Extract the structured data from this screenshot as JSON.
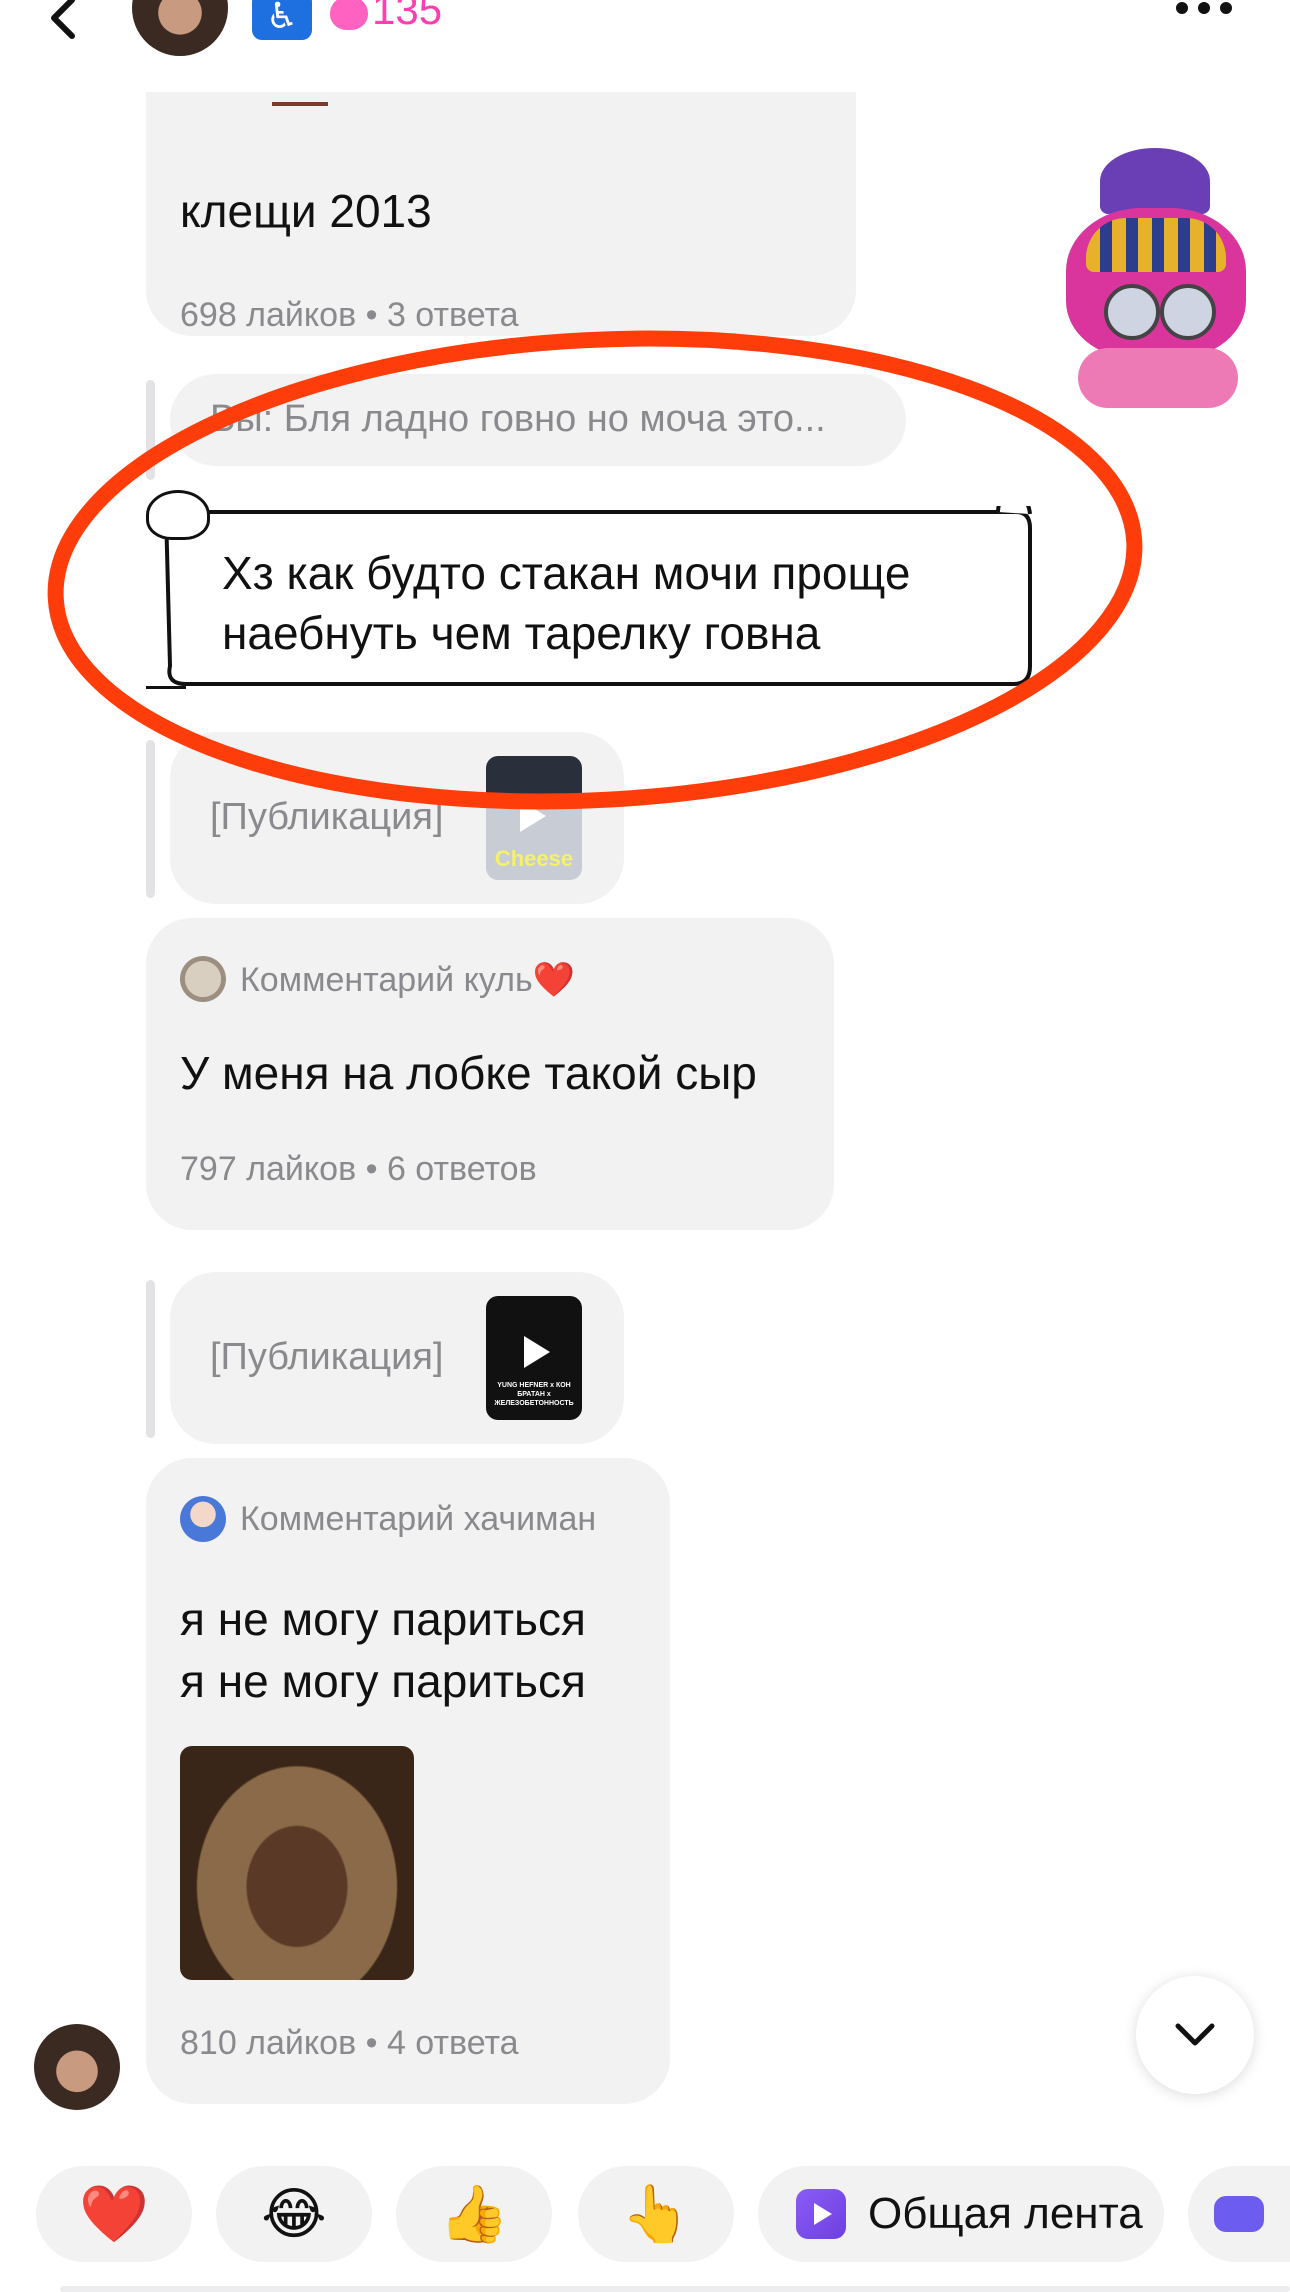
{
  "header": {
    "streak": "135",
    "back_icon": "chevron-left-icon",
    "more_icon": "ellipsis-icon",
    "badge_icon": "accessibility-icon",
    "streak_icon": "flame-icon"
  },
  "messages": {
    "top_comment": {
      "text": "клещи 2013",
      "meta": "698 лайков • 3 ответа"
    },
    "reply_preview": "Вы: Бля ладно говно но моча это...",
    "scroll_message": {
      "line1": "Хз как будто стакан мочи проще",
      "line2": "наебнуть чем тарелку говна"
    },
    "post1": {
      "label": "[Публикация]",
      "thumb_caption": "Cheese"
    },
    "comment1": {
      "author": "Комментарий куль",
      "heart": "❤️",
      "text": "У меня на лобке такой сыр",
      "meta": "797 лайков • 6 ответов"
    },
    "post2": {
      "label": "[Публикация]",
      "thumb_caption": "YUNG HEFNER x КОН БРАТАН x ЖЕЛЕЗОБЕТОННОСТЬ"
    },
    "comment2": {
      "author": "Комментарий хачиман",
      "line1": "я не могу париться",
      "line2": "я не могу париться",
      "meta": "810 лайков • 4 ответа"
    }
  },
  "quick_bar": {
    "heart": "❤️",
    "laugh": "😂",
    "thumbs_up": "👍",
    "point": "👆",
    "feed_label": "Общая лента",
    "feed_icon": "feed-icon",
    "game_icon": "gamepad-icon"
  },
  "colors": {
    "accent_pink": "#ff3fb0",
    "annotation_red": "#ff3d0a",
    "bubble_bg": "#f2f2f3"
  }
}
